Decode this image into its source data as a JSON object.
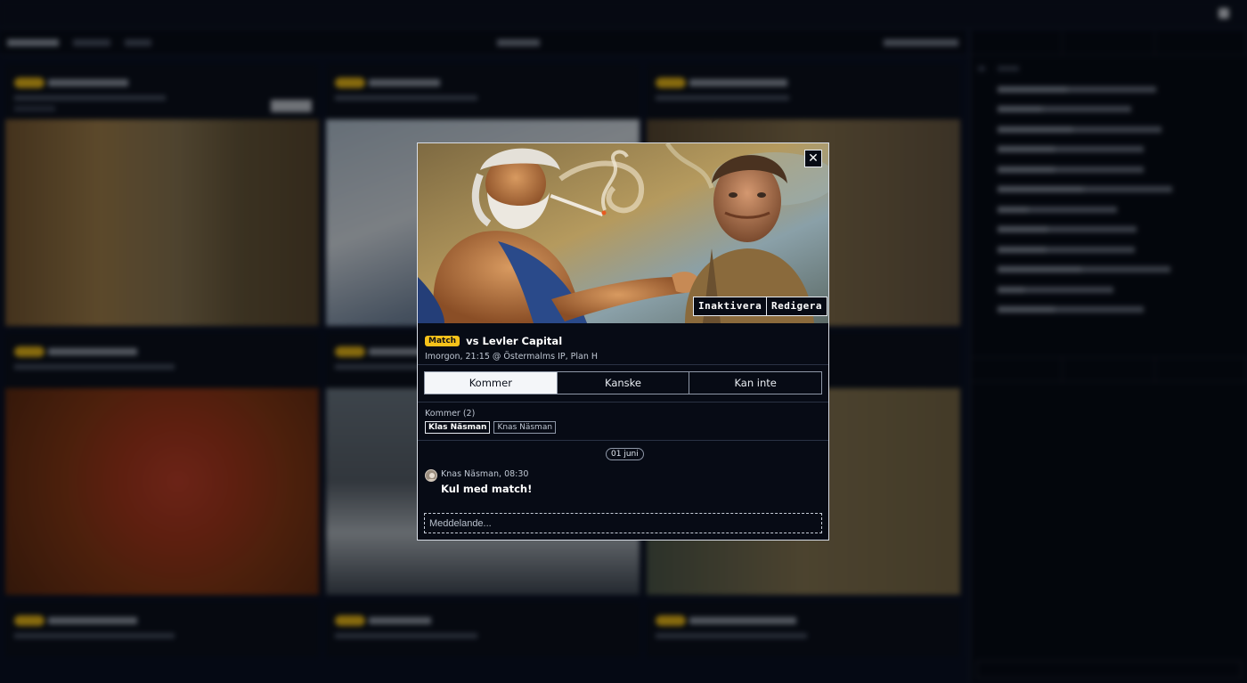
{
  "modal": {
    "close_icon": "close-icon",
    "deactivate_label": "Inaktivera",
    "edit_label": "Redigera",
    "event_type": "Match",
    "title": "vs Levler Capital",
    "meta": "Imorgon, 21:15 @ Östermalms IP, Plan H",
    "rsvp_options": [
      "Kommer",
      "Kanske",
      "Kan inte"
    ],
    "rsvp_selected": "Kommer",
    "attending_label": "Kommer (2)",
    "attendees": [
      "Klas Näsman",
      "Knas Näsman"
    ],
    "chat": {
      "date": "01 juni",
      "messages": [
        {
          "author": "Knas Näsman",
          "time": "08:30",
          "text": "Kul med match!"
        }
      ],
      "input_placeholder": "Meddelande..."
    }
  },
  "colors": {
    "accent": "#f6c21a",
    "background": "#050914",
    "border": "#d8dde6"
  }
}
